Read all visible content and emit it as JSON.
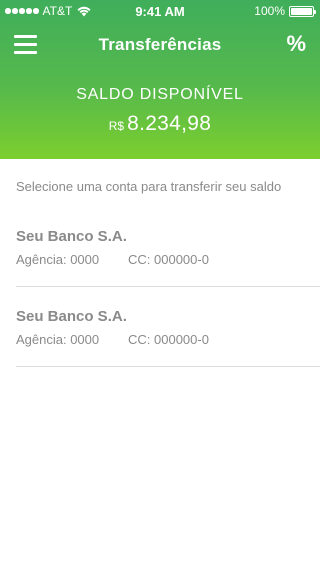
{
  "status_bar": {
    "carrier": "AT&T",
    "time": "9:41 AM",
    "battery": "100%",
    "signal_icon": "signal-dots-icon",
    "wifi_icon": "wifi-icon",
    "battery_icon": "battery-icon"
  },
  "nav": {
    "title": "Transferências",
    "menu_icon": "hamburger-menu-icon",
    "right_button": "%"
  },
  "balance": {
    "label": "SALDO DISPONÍVEL",
    "currency": "R$",
    "amount": "8.234,98"
  },
  "instruction": "Selecione uma conta para transferir seu saldo",
  "accounts": [
    {
      "name": "Seu Banco S.A.",
      "agency": "Agência: 0000",
      "cc": "CC: 000000-0"
    },
    {
      "name": "Seu Banco S.A.",
      "agency": "Agência: 0000",
      "cc": "CC: 000000-0"
    }
  ],
  "colors": {
    "header_top": "#3fae5b",
    "header_bottom": "#7ccf2e",
    "text_muted": "#8a8a8a",
    "divider": "#dcdcdc"
  }
}
